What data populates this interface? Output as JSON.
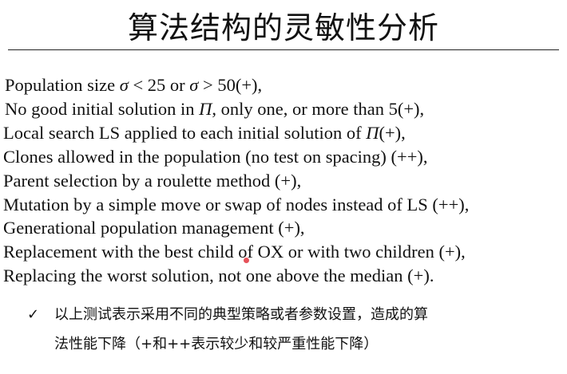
{
  "slide": {
    "title": "算法结构的灵敏性分析",
    "items": [
      {
        "pre": "Population size ",
        "m1": "σ",
        "mid": " < 25 or ",
        "m2": "σ",
        "post": " > 50(+),"
      },
      {
        "pre": "No good initial solution in ",
        "m1": "Π",
        "post": ", only one, or more than 5(+),"
      },
      {
        "pre": "Local search LS applied to each initial solution of ",
        "m1": "Π",
        "post": "(+),"
      },
      {
        "text": "Clones allowed in the population (no test on spacing) (++),"
      },
      {
        "text": "Parent selection by a roulette method (+),"
      },
      {
        "text": "Mutation by a simple move or swap of nodes instead of LS (++),"
      },
      {
        "text": "Generational population management (+),"
      },
      {
        "text": "Replacement with the best child of OX or with two children (+),"
      },
      {
        "text": "Replacing the worst solution, not one above the median (+)."
      }
    ],
    "note": {
      "check_icon": "✓",
      "line1": "以上测试表示采用不同的典型策略或者参数设置，造成的算",
      "line2": "法性能下降（+和++表示较少和较严重性能下降）"
    },
    "colors": {
      "text": "#111111",
      "background": "#ffffff",
      "pointer": "#e2323c"
    }
  }
}
